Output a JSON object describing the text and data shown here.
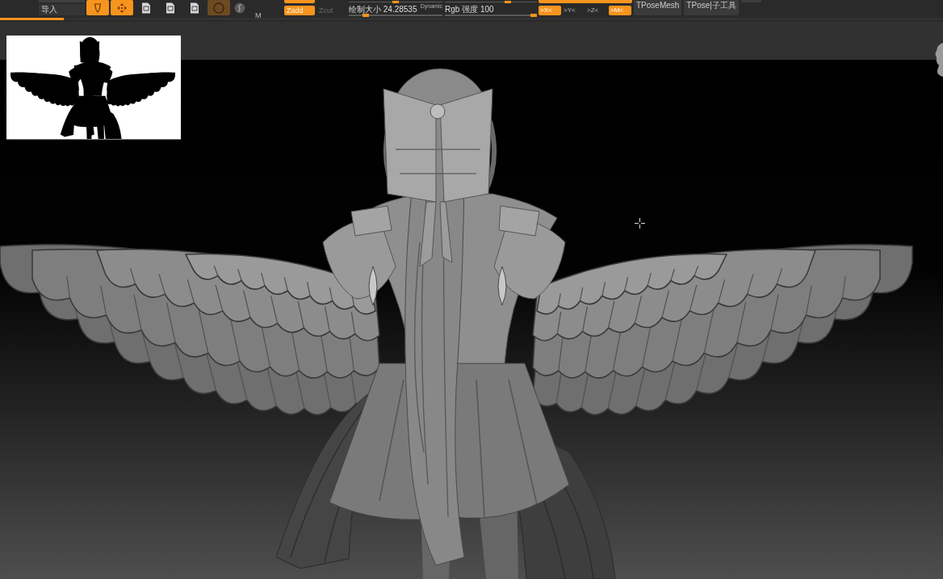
{
  "toolbar": {
    "import_button": "导入",
    "tool_buttons": [
      {
        "kind": "pencil",
        "selected": true,
        "disabled": false
      },
      {
        "kind": "move",
        "selected": true,
        "disabled": false
      },
      {
        "kind": "document",
        "selected": false,
        "disabled": false
      },
      {
        "kind": "document",
        "selected": false,
        "disabled": false
      },
      {
        "kind": "document",
        "selected": false,
        "disabled": false
      },
      {
        "kind": "ring",
        "selected": true,
        "disabled": true
      },
      {
        "kind": "sphere",
        "selected": false,
        "disabled": false
      }
    ],
    "mode_letter": "M",
    "mode_buttons": [
      {
        "label": "Zadd",
        "selected": true
      },
      {
        "label": "Zcut",
        "selected": false
      }
    ],
    "sliders": [
      {
        "label": "绘制大小 24.28535",
        "badge": "Dynamic",
        "level": 0.16
      },
      {
        "label": "Rgb 强度 100",
        "level": 1
      }
    ],
    "symmetry_buttons": [
      {
        "label": ">X<",
        "selected": true
      },
      {
        "label": ">Y<",
        "selected": false
      },
      {
        "label": ">Z<",
        "selected": false
      },
      {
        "label": ">M<",
        "selected": true
      }
    ],
    "tpose_buttons": [
      "TPoseMesh",
      "TPose|子工具"
    ]
  },
  "upper_row": {
    "buttons": [
      {
        "selected": true
      },
      {
        "selected": true
      },
      {
        "selected": false
      }
    ],
    "sliders": [
      {
        "level": 0.5
      },
      {
        "level": 0.7
      }
    ]
  },
  "progress": {
    "level": 0.068
  }
}
